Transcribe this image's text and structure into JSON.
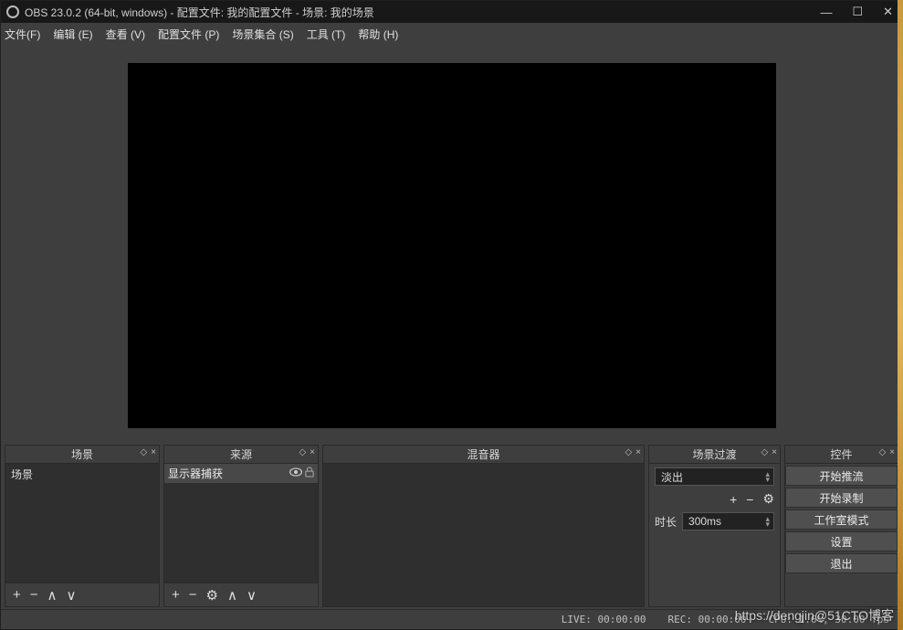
{
  "titlebar": {
    "title": "OBS 23.0.2 (64-bit, windows) - 配置文件: 我的配置文件 - 场景: 我的场景"
  },
  "menu": {
    "file": "文件(F)",
    "edit": "编辑 (E)",
    "view": "查看 (V)",
    "profile": "配置文件 (P)",
    "scene_collection": "场景集合 (S)",
    "tools": "工具 (T)",
    "help": "帮助 (H)"
  },
  "docks": {
    "scenes": {
      "title": "场景",
      "item": "场景"
    },
    "sources": {
      "title": "来源",
      "item": "显示器捕获"
    },
    "mixer": {
      "title": "混音器"
    },
    "transitions": {
      "title": "场景过渡",
      "selected": "淡出",
      "duration_label": "时长",
      "duration_value": "300ms"
    },
    "controls": {
      "title": "控件",
      "start_stream": "开始推流",
      "start_record": "开始录制",
      "studio_mode": "工作室模式",
      "settings": "设置",
      "exit": "退出"
    }
  },
  "status": {
    "live": "LIVE: 00:00:00",
    "rec": "REC: 00:00:00",
    "cpu": "CPU: 1.6%, 30.00 fps"
  },
  "watermark": "https://dengjin@51CTO博客"
}
